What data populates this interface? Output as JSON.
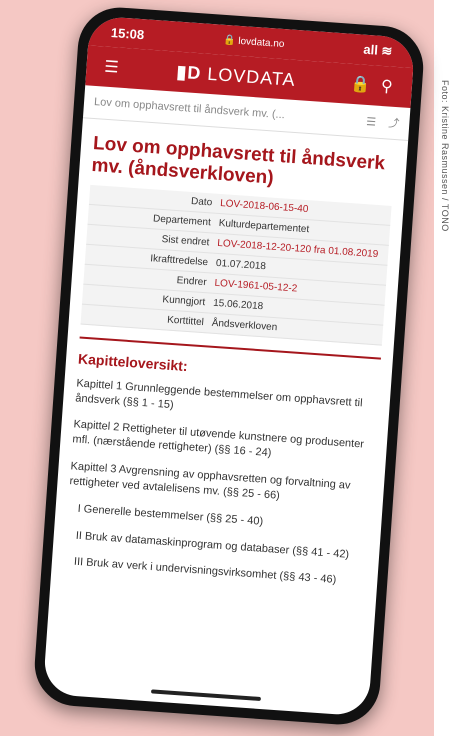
{
  "status": {
    "time": "15:08",
    "url": "lovdata.no",
    "signal": "all ≋"
  },
  "header": {
    "logo": "LOVDATA"
  },
  "crumb": {
    "text": "Lov om opphavsrett til åndsverk mv. (..."
  },
  "doc": {
    "title": "Lov om opphavsrett til åndsverk mv. (åndsverkloven)",
    "meta": [
      {
        "k": "Dato",
        "v": "LOV-2018-06-15-40"
      },
      {
        "k": "Departement",
        "v": "Kulturdepartementet"
      },
      {
        "k": "Sist endret",
        "v": "LOV-2018-12-20-120 fra 01.08.2019"
      },
      {
        "k": "Ikrafttredelse",
        "v": "01.07.2018"
      },
      {
        "k": "Endrer",
        "v": "LOV-1961-05-12-2"
      },
      {
        "k": "Kunngjort",
        "v": "15.06.2018"
      },
      {
        "k": "Korttittel",
        "v": "Åndsverkloven"
      }
    ],
    "overview_title": "Kapitteloversikt:",
    "chapters": [
      "Kapittel 1 Grunnleggende bestemmelser om opphavsrett til åndsverk (§§ 1 - 15)",
      "Kapittel 2 Rettigheter til utøvende kunstnere og produsenter mfl. (nærstående rettigheter) (§§ 16 - 24)",
      "Kapittel 3 Avgrensning av opphavsretten og forvaltning av rettigheter ved avtalelisens mv. (§§ 25 - 66)",
      "I Generelle bestemmelser (§§ 25 - 40)",
      "II Bruk av datamaskinprogram og databaser (§§ 41 - 42)",
      "III Bruk av verk i undervisningsvirksomhet (§§ 43 - 46)"
    ]
  },
  "credit": "Foto: Kristine Rasmussen / TONO"
}
